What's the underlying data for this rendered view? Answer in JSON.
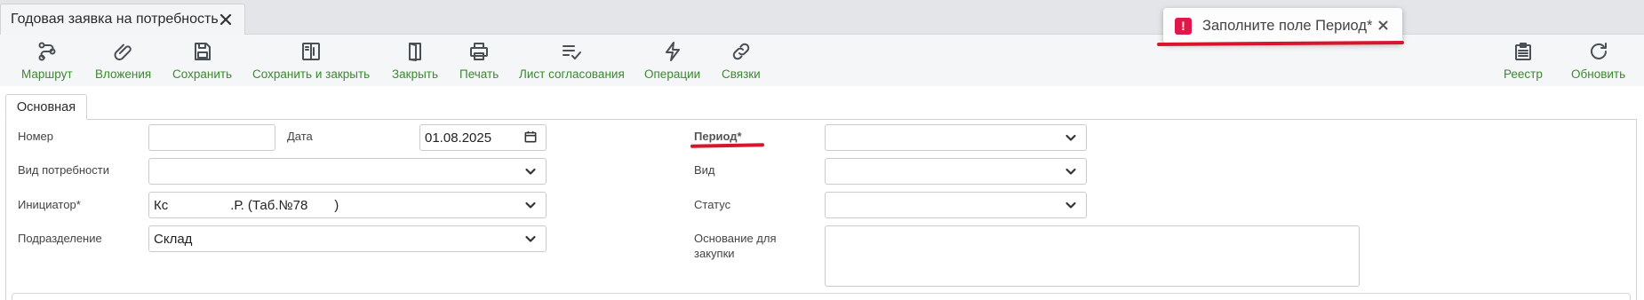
{
  "tab": {
    "title": "Годовая заявка на потребность"
  },
  "toolbar": {
    "left": [
      {
        "label": "Маршрут",
        "icon": "route-icon"
      },
      {
        "label": "Вложения",
        "icon": "paperclip-icon"
      },
      {
        "label": "Сохранить",
        "icon": "save-icon"
      },
      {
        "label": "Сохранить и закрыть",
        "icon": "save-close-icon"
      },
      {
        "label": "Закрыть",
        "icon": "door-icon"
      },
      {
        "label": "Печать",
        "icon": "printer-icon"
      },
      {
        "label": "Лист согласования",
        "icon": "approval-list-icon"
      },
      {
        "label": "Операции",
        "icon": "lightning-icon"
      },
      {
        "label": "Связки",
        "icon": "link-icon"
      }
    ],
    "right": [
      {
        "label": "Реестр",
        "icon": "registry-icon"
      },
      {
        "label": "Обновить",
        "icon": "refresh-icon"
      }
    ]
  },
  "toast": {
    "message": "Заполните поле Период*"
  },
  "form": {
    "tab_label": "Основная",
    "fields": {
      "nomer": {
        "label": "Номер",
        "value": ""
      },
      "data": {
        "label": "Дата",
        "value": "01.08.2025"
      },
      "period": {
        "label": "Период*",
        "value": ""
      },
      "vid_potrebnosti": {
        "label": "Вид потребности",
        "value": ""
      },
      "vid": {
        "label": "Вид",
        "value": ""
      },
      "initiator": {
        "label": "Инициатор*",
        "value_start": "Кс",
        "value_mid": ".Р. (Таб.№78",
        "value_end": ")"
      },
      "status": {
        "label": "Статус",
        "value": ""
      },
      "podrazdelenie": {
        "label": "Подразделение",
        "value": "Склад"
      },
      "osnovanie": {
        "label": "Основание для закупки",
        "value": ""
      }
    }
  },
  "colors": {
    "accent_green": "#3a8a2e",
    "error_red": "#e0184a",
    "underline_red": "#d8152b"
  }
}
